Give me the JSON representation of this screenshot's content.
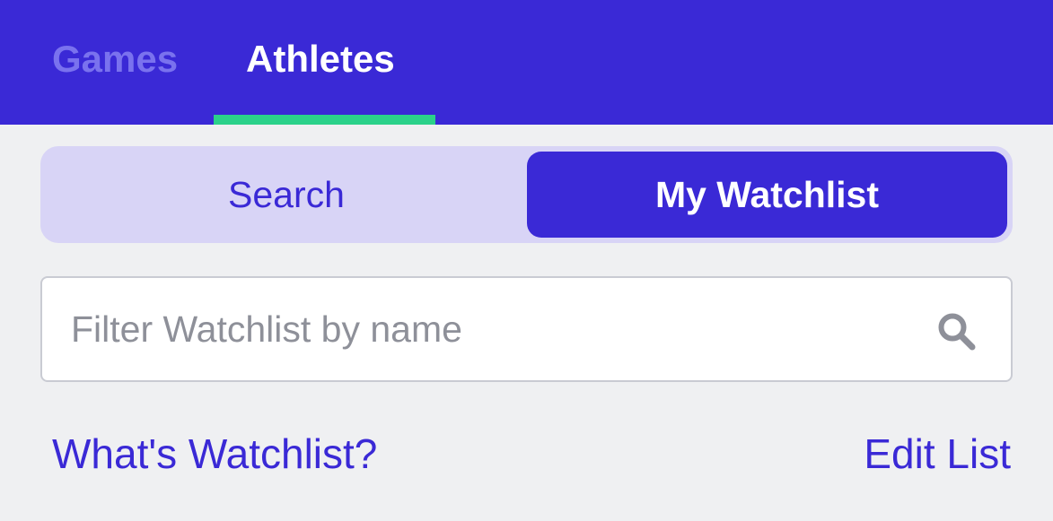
{
  "top_tabs": {
    "games_label": "Games",
    "athletes_label": "Athletes",
    "active": "Athletes"
  },
  "segmented": {
    "search_label": "Search",
    "watchlist_label": "My Watchlist",
    "active": "My Watchlist"
  },
  "filter": {
    "placeholder": "Filter Watchlist by name",
    "value": "",
    "icon": "search-icon"
  },
  "links": {
    "whats_watchlist": "What's Watchlist?",
    "edit_list": "Edit List"
  },
  "colors": {
    "brand": "#3a29d6",
    "active_tab_indicator": "#2bd18a",
    "inactive_tab_text": "#7a72ee",
    "segmented_track": "#d8d4f6",
    "background": "#eff0f2",
    "placeholder": "#8e9099"
  }
}
